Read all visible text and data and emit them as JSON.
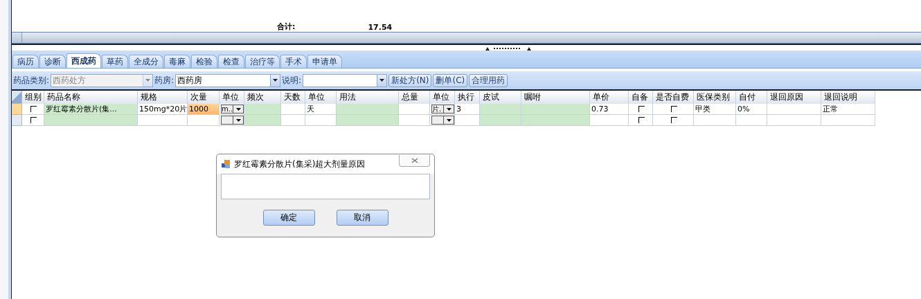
{
  "summary": {
    "label": "合计:",
    "value": "17.54"
  },
  "tabs": [
    {
      "label": "病历",
      "selected": false
    },
    {
      "label": "诊断",
      "selected": false
    },
    {
      "label": "西成药",
      "selected": true
    },
    {
      "label": "草药",
      "selected": false
    },
    {
      "label": "全成分",
      "selected": false
    },
    {
      "label": "毒麻",
      "selected": false
    },
    {
      "label": "检验",
      "selected": false
    },
    {
      "label": "检查",
      "selected": false
    },
    {
      "label": "治疗等",
      "selected": false
    },
    {
      "label": "手术",
      "selected": false
    },
    {
      "label": "申请单",
      "selected": false
    }
  ],
  "toolbar": {
    "fields": [
      {
        "label": "药品类别:",
        "value": "西药处方",
        "disabled": true
      },
      {
        "label": "药房:",
        "value": "西药房",
        "disabled": false
      },
      {
        "label": "说明:",
        "disabled": false
      }
    ],
    "buttons": [
      "新处方(N)",
      "删单(C)",
      "合理用药"
    ]
  },
  "table": {
    "columns": [
      {
        "label": "组别",
        "kind": "check"
      },
      {
        "label": "药品名称",
        "kind": "green"
      },
      {
        "label": "规格",
        "kind": "text"
      },
      {
        "label": "次量",
        "kind": "text"
      },
      {
        "label": "单位",
        "kind": "combo"
      },
      {
        "label": "频次",
        "kind": "green"
      },
      {
        "label": "天数",
        "kind": "text"
      },
      {
        "label": "单位",
        "kind": "text"
      },
      {
        "label": "用法",
        "kind": "green"
      },
      {
        "label": "总量",
        "kind": "text"
      },
      {
        "label": "单位",
        "kind": "combo"
      },
      {
        "label": "执行",
        "kind": "text"
      },
      {
        "label": "皮试",
        "kind": "green"
      },
      {
        "label": "嘱咐",
        "kind": "green"
      },
      {
        "label": "单价",
        "kind": "text"
      },
      {
        "label": "自备",
        "kind": "check"
      },
      {
        "label": "是否自费",
        "kind": "check"
      },
      {
        "label": "医保类别",
        "kind": "text"
      },
      {
        "label": "自付",
        "kind": "text"
      },
      {
        "label": "退回原因",
        "kind": "text"
      },
      {
        "label": "退回说明",
        "kind": "text"
      }
    ],
    "rows": [
      {
        "current": true,
        "cells": [
          {
            "checked": false,
            "selected": false
          },
          {
            "text": "罗红霉素分散片(集...",
            "selected": false
          },
          {
            "text": "150mg*20片",
            "selected": false
          },
          {
            "text": "1000",
            "selected": true
          },
          {
            "text": "m..",
            "selected": false
          },
          {
            "text": "",
            "selected": false
          },
          {
            "text": "",
            "selected": false
          },
          {
            "text": "天",
            "selected": false
          },
          {
            "text": "",
            "selected": false
          },
          {
            "text": "",
            "selected": false
          },
          {
            "text": "片.",
            "selected": false
          },
          {
            "text": "3",
            "selected": false
          },
          {
            "text": "",
            "selected": false
          },
          {
            "text": "",
            "selected": false
          },
          {
            "text": "0.73",
            "selected": false
          },
          {
            "checked": false,
            "selected": false
          },
          {
            "checked": false,
            "selected": false
          },
          {
            "text": "甲类",
            "selected": false
          },
          {
            "text": "0%",
            "selected": false
          },
          {
            "text": "",
            "selected": false
          },
          {
            "text": "正常",
            "selected": false
          }
        ]
      },
      {
        "current": false,
        "cells": [
          {
            "checked": false,
            "selected": false
          },
          {
            "text": "",
            "selected": false
          },
          {
            "text": "",
            "selected": false
          },
          {
            "text": "",
            "selected": false
          },
          {
            "text": "",
            "selected": false
          },
          {
            "text": "",
            "selected": false
          },
          {
            "text": "",
            "selected": false
          },
          {
            "text": "",
            "selected": false
          },
          {
            "text": "",
            "selected": false
          },
          {
            "text": "",
            "selected": false
          },
          {
            "text": "",
            "selected": false
          },
          {
            "text": "",
            "selected": false
          },
          {
            "text": "",
            "selected": false
          },
          {
            "text": "",
            "selected": false
          },
          {
            "text": "",
            "selected": false
          },
          {
            "checked": false,
            "selected": false
          },
          {
            "checked": false,
            "selected": false
          },
          {
            "text": "",
            "selected": false
          },
          {
            "text": "",
            "selected": false
          },
          {
            "text": "",
            "selected": false
          },
          {
            "text": "",
            "selected": false
          }
        ]
      }
    ]
  },
  "dialog": {
    "title": "罗红霉素分散片(集采)超大剂量原因",
    "buttons": [
      "确定",
      "取消"
    ]
  }
}
